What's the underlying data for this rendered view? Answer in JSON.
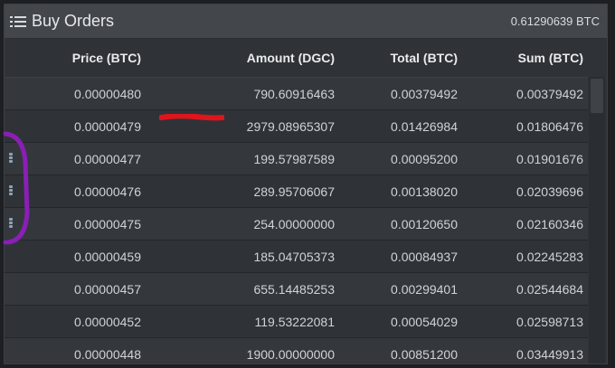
{
  "panel": {
    "title": "Buy Orders",
    "total_value": "0.61290639 BTC",
    "icon": "list-icon"
  },
  "table": {
    "columns": [
      "Price (BTC)",
      "Amount (DGC)",
      "Total (BTC)",
      "Sum (BTC)"
    ],
    "rows": [
      [
        "0.00000480",
        "790.60916463",
        "0.00379492",
        "0.00379492"
      ],
      [
        "0.00000479",
        "2979.08965307",
        "0.01426984",
        "0.01806476"
      ],
      [
        "0.00000477",
        "199.57987589",
        "0.00095200",
        "0.01901676"
      ],
      [
        "0.00000476",
        "289.95706067",
        "0.00138020",
        "0.02039696"
      ],
      [
        "0.00000475",
        "254.00000000",
        "0.00120650",
        "0.02160346"
      ],
      [
        "0.00000459",
        "185.04705373",
        "0.00084937",
        "0.02245283"
      ],
      [
        "0.00000457",
        "655.14485253",
        "0.00299401",
        "0.02544684"
      ],
      [
        "0.00000452",
        "119.53222081",
        "0.00054029",
        "0.02598713"
      ],
      [
        "0.00000448",
        "1900.00000000",
        "0.00851200",
        "0.03449913"
      ]
    ]
  },
  "colors": {
    "annotation_red": "#e0141c",
    "annotation_purple": "#8a1fb5"
  }
}
